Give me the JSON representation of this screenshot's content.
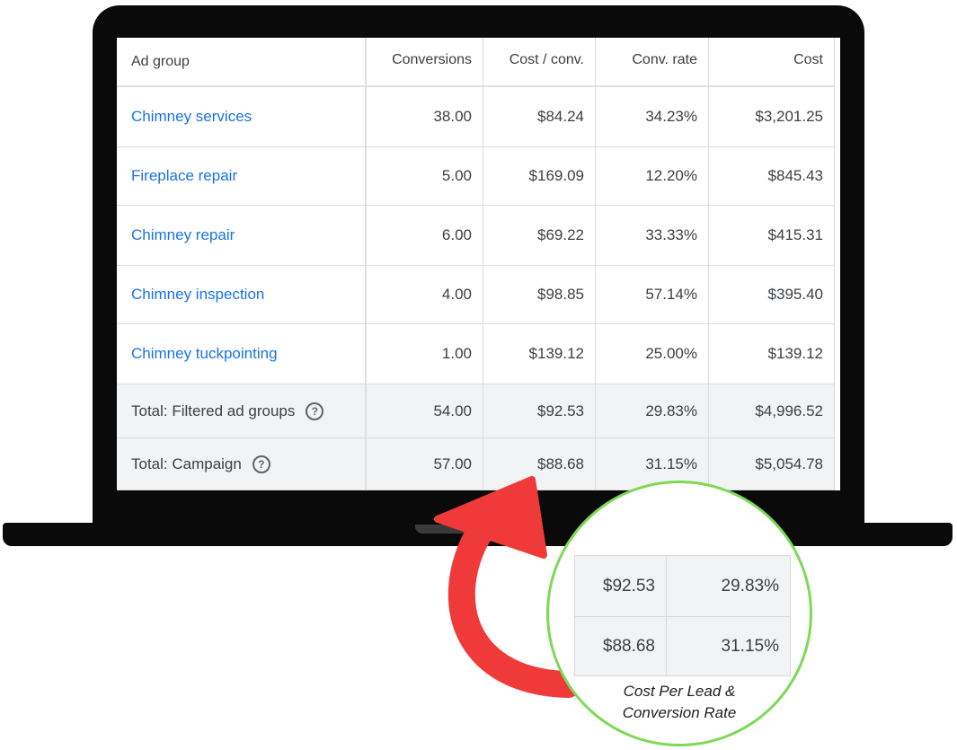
{
  "table": {
    "headers": [
      "Ad group",
      "Conversions",
      "Cost / conv.",
      "Conv. rate",
      "Cost"
    ],
    "rows": [
      [
        "Chimney services",
        "38.00",
        "$84.24",
        "34.23%",
        "$3,201.25"
      ],
      [
        "Fireplace repair",
        "5.00",
        "$169.09",
        "12.20%",
        "$845.43"
      ],
      [
        "Chimney repair",
        "6.00",
        "$69.22",
        "33.33%",
        "$415.31"
      ],
      [
        "Chimney inspection",
        "4.00",
        "$98.85",
        "57.14%",
        "$395.40"
      ],
      [
        "Chimney tuckpointing",
        "1.00",
        "$139.12",
        "25.00%",
        "$139.12"
      ]
    ],
    "totals": [
      [
        "Total: Filtered ad groups",
        "54.00",
        "$92.53",
        "29.83%",
        "$4,996.52"
      ],
      [
        "Total: Campaign",
        "57.00",
        "$88.68",
        "31.15%",
        "$5,054.78"
      ]
    ],
    "help_glyph": "?"
  },
  "zoom": {
    "cells": [
      [
        "$92.53",
        "29.83%"
      ],
      [
        "$88.68",
        "31.15%"
      ]
    ],
    "caption_line1": "Cost Per Lead &",
    "caption_line2": "Conversion Rate"
  },
  "colors": {
    "link": "#1a73e8",
    "arrow": "#f03a3a",
    "circle": "#7ed957",
    "laptop": "#0a0a0a"
  },
  "icons": {
    "help": "help-circle-icon",
    "arrow": "curved-arrow-icon"
  }
}
